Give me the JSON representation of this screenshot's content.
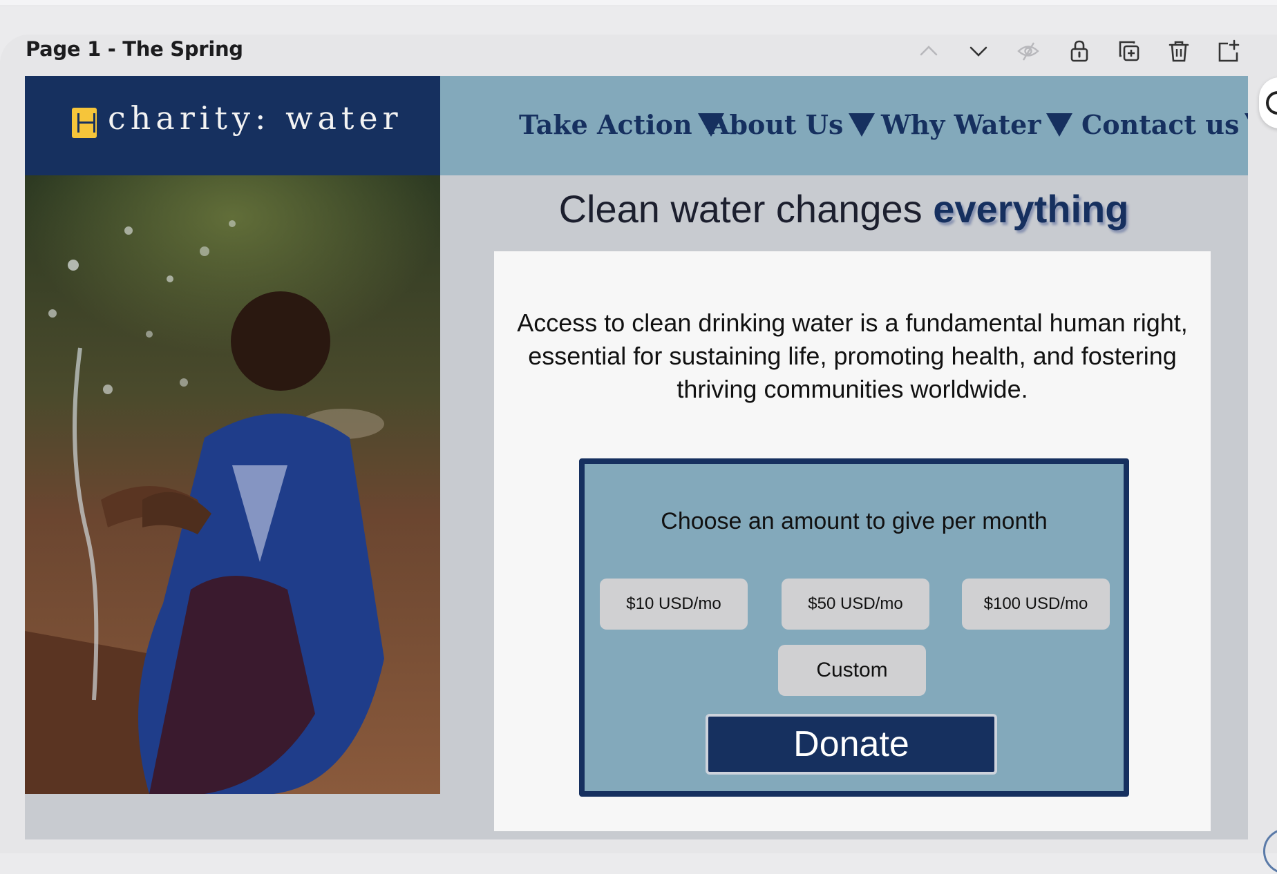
{
  "editor": {
    "page_label": "Page 1 - The Spring",
    "toolbar_icons": [
      "chevron-up-icon",
      "chevron-down-icon",
      "hide-eye-icon",
      "lock-icon",
      "duplicate-icon",
      "trash-icon",
      "add-page-icon"
    ]
  },
  "site": {
    "brand": "charity: water",
    "nav": [
      {
        "label": "Take Action"
      },
      {
        "label": "About Us"
      },
      {
        "label": "Why Water"
      },
      {
        "label": "Contact us"
      }
    ],
    "headline_lead": "Clean water changes ",
    "headline_accent": "everything",
    "intro": "Access to clean drinking water is a fundamental human right, essential for sustaining life, promoting health, and fostering thriving communities worldwide.",
    "donate": {
      "prompt": "Choose an amount to give per month",
      "amounts": [
        "$10 USD/mo",
        "$50 USD/mo",
        "$100 USD/mo"
      ],
      "custom_label": "Custom",
      "submit_label": "Donate"
    }
  },
  "colors": {
    "navy": "#16305f",
    "nav_blue": "#83a9bb",
    "logo_yellow": "#f6c53a"
  }
}
